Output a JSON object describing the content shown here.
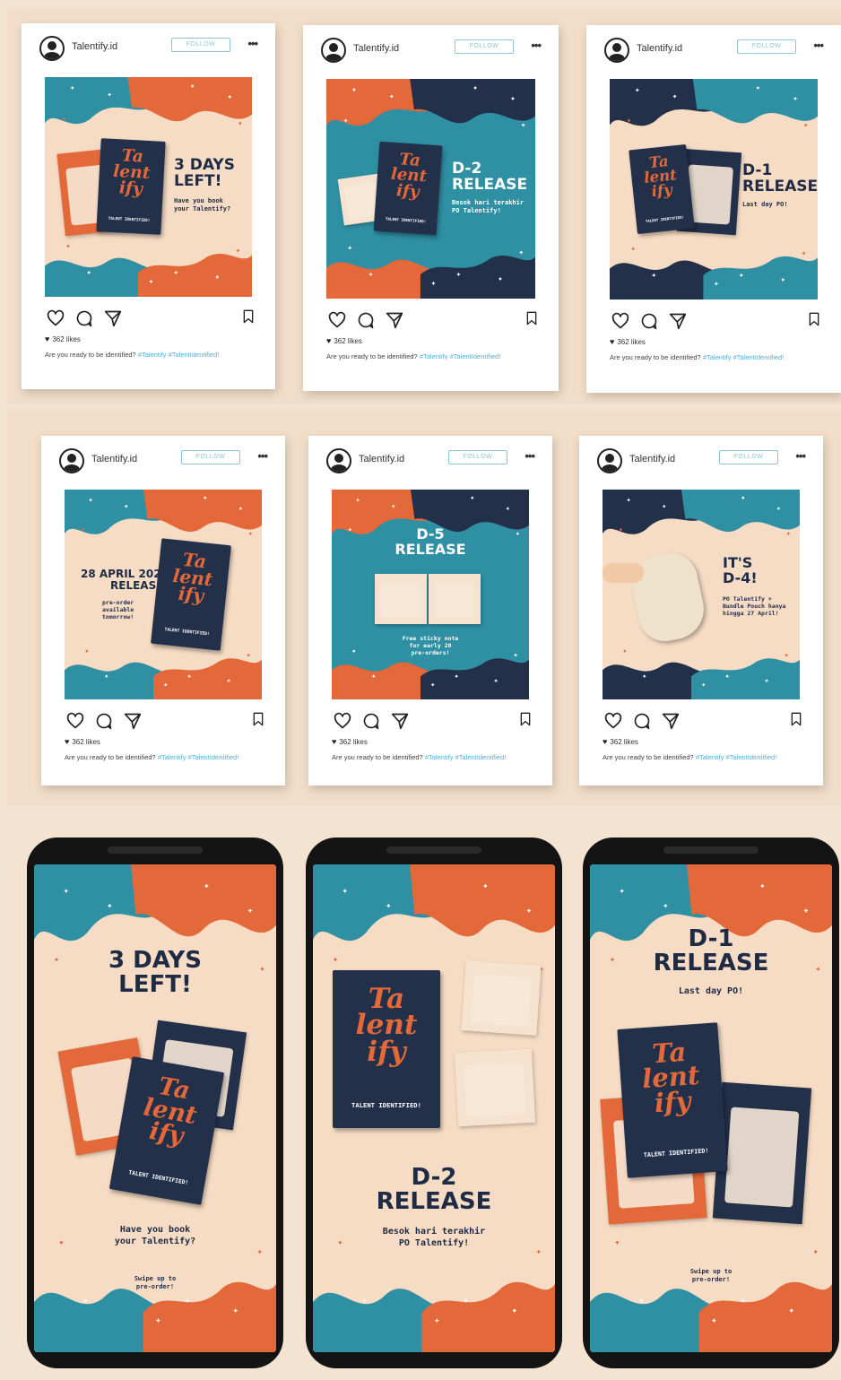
{
  "colors": {
    "navy": "#23304a",
    "orange": "#e3683a",
    "teal": "#2f8fa3",
    "cream": "#f6dcc4",
    "background": "#f1ddc8"
  },
  "ig": {
    "username": "Talentify.id",
    "follow_label": "FOLLOW",
    "more_label": "•••",
    "likes": "362 likes",
    "caption": "Are you ready to be identified?",
    "hashtags": "#Talentify #TalentIdentified!",
    "icons": [
      "heart-icon",
      "comment-icon",
      "share-icon",
      "bookmark-icon",
      "profile-icon"
    ]
  },
  "book": {
    "logo_lines": [
      "Ta",
      "lent",
      "ify"
    ],
    "subtitle": "TALENT IDENTIFIED!"
  },
  "posts": [
    {
      "title_lines": [
        "3 DAYS",
        "LEFT!"
      ],
      "sub_lines": [
        "Have you book",
        "your Talentify?"
      ]
    },
    {
      "title_lines": [
        "D-2",
        "RELEASE"
      ],
      "sub_lines": [
        "Besok hari terakhir",
        "PO Talentify!"
      ]
    },
    {
      "title_lines": [
        "D-1",
        "RELEASE"
      ],
      "sub_lines": [
        "Last day PO!"
      ]
    },
    {
      "title_lines": [
        "28 APRIL 2020",
        "RELEASE!"
      ],
      "sub_lines": [
        "pre-order",
        "available",
        "tomorrow!"
      ]
    },
    {
      "title_lines": [
        "D-5",
        "RELEASE"
      ],
      "sub_lines": [
        "Free sticky note",
        "for early 20",
        "pre-orders!"
      ]
    },
    {
      "title_lines": [
        "IT'S",
        "D-4!"
      ],
      "sub_lines": [
        "PO Talentify +",
        "Bundle Pouch hanya",
        "hingga 27 April!"
      ]
    }
  ],
  "stories": [
    {
      "title_lines": [
        "3 DAYS",
        "LEFT!"
      ],
      "sub_lines": [
        "Have you book",
        "your Talentify?"
      ],
      "footer_lines": [
        "Swipe up to",
        "pre-order!"
      ]
    },
    {
      "title_lines": [
        "D-2",
        "RELEASE"
      ],
      "sub_lines": [
        "Besok hari terakhir",
        "PO Talentify!"
      ],
      "footer_lines": []
    },
    {
      "title_lines": [
        "D-1",
        "RELEASE"
      ],
      "sub_lines": [
        "Last day PO!"
      ],
      "footer_lines": [
        "Swipe up to",
        "pre-order!"
      ]
    }
  ]
}
